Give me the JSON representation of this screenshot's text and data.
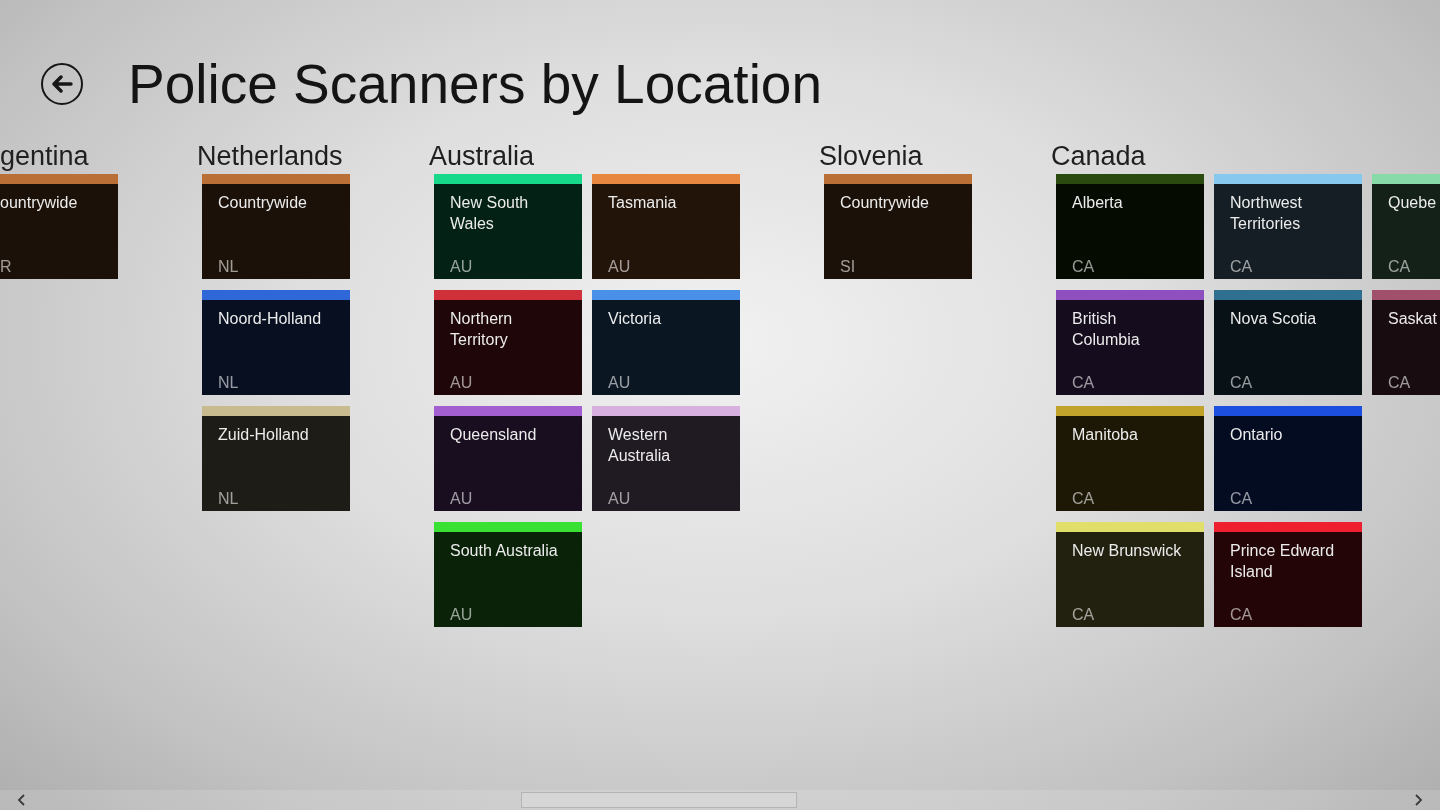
{
  "header": {
    "title": "Police Scanners by Location"
  },
  "groups": [
    {
      "title": "gentina",
      "tiles": [
        {
          "name": "ountrywide",
          "code": "R",
          "color": "#b96f35"
        }
      ]
    },
    {
      "title": "Netherlands",
      "tiles": [
        {
          "name": "Countrywide",
          "code": "NL",
          "color": "#b96f35"
        },
        {
          "name": "Noord-Holland",
          "code": "NL",
          "color": "#2f66d8"
        },
        {
          "name": "Zuid-Holland",
          "code": "NL",
          "color": "#c8bb90"
        }
      ]
    },
    {
      "title": "Australia",
      "tiles": [
        {
          "name": "New South Wales",
          "code": "AU",
          "color": "#17d98a"
        },
        {
          "name": "Northern Territory",
          "code": "AU",
          "color": "#d0303a"
        },
        {
          "name": "Queensland",
          "code": "AU",
          "color": "#a35fd0"
        },
        {
          "name": "South Australia",
          "code": "AU",
          "color": "#3be034"
        },
        {
          "name": "Tasmania",
          "code": "AU",
          "color": "#e88840"
        },
        {
          "name": "Victoria",
          "code": "AU",
          "color": "#4a90e8"
        },
        {
          "name": "Western Australia",
          "code": "AU",
          "color": "#d8b0e0"
        }
      ]
    },
    {
      "title": "Slovenia",
      "tiles": [
        {
          "name": "Countrywide",
          "code": "SI",
          "color": "#b96f35"
        }
      ]
    },
    {
      "title": "Canada",
      "tiles": [
        {
          "name": "Alberta",
          "code": "CA",
          "color": "#2a4a10"
        },
        {
          "name": "British Columbia",
          "code": "CA",
          "color": "#8e4fbf"
        },
        {
          "name": "Manitoba",
          "code": "CA",
          "color": "#c1a22a"
        },
        {
          "name": "New Brunswick",
          "code": "CA",
          "color": "#e0df6c"
        },
        {
          "name": "Northwest Territories",
          "code": "CA",
          "color": "#86c8ee"
        },
        {
          "name": "Nova Scotia",
          "code": "CA",
          "color": "#2f7090"
        },
        {
          "name": "Ontario",
          "code": "CA",
          "color": "#1c4ee0"
        },
        {
          "name": "Prince Edward Island",
          "code": "CA",
          "color": "#ee2030"
        },
        {
          "name": "Quebe",
          "code": "CA",
          "color": "#88dba8"
        },
        {
          "name": "Saskat",
          "code": "CA",
          "color": "#a0506a"
        }
      ]
    }
  ]
}
